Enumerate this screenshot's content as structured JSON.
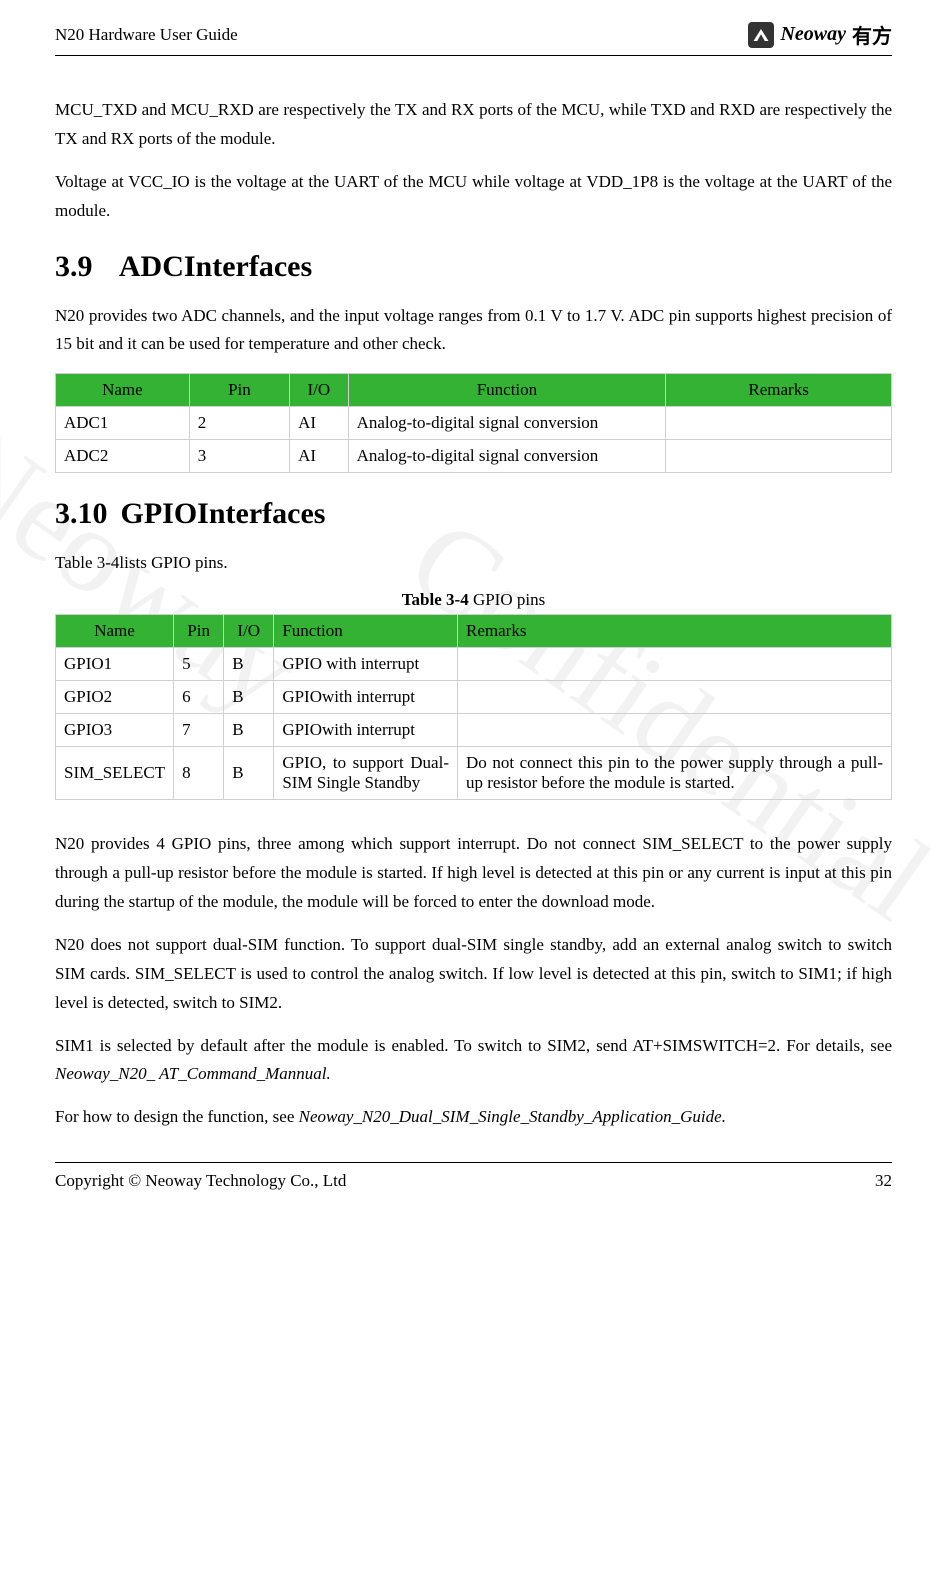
{
  "header": {
    "title": "N20 Hardware User Guide",
    "logo_text": "Neoway",
    "logo_cn": "有方"
  },
  "paras": {
    "p1": "MCU_TXD and MCU_RXD are respectively the TX and RX ports of the MCU, while TXD and RXD are respectively the TX and RX ports of the module.",
    "p2": "Voltage at VCC_IO is the voltage at the UART of the MCU while voltage at VDD_1P8 is the voltage at the UART of the module.",
    "p3": "N20 provides two ADC channels, and the input voltage ranges from 0.1 V to 1.7 V. ADC pin supports highest precision of 15 bit and it can be used for temperature and other check.",
    "p4": "Table 3-4lists GPIO pins.",
    "p5": "N20 provides 4 GPIO pins, three among which support interrupt. Do not connect SIM_SELECT to the power supply through a pull-up resistor before the module is started. If high level is detected at this pin or any current is input at this pin during the startup of the module, the module will be forced to enter the download mode.",
    "p6": "N20 does not support dual-SIM function. To support dual-SIM single standby, add an external analog switch to switch SIM cards. SIM_SELECT is used to control the analog switch. If low level is detected at this pin, switch to SIM1; if high level is detected, switch to SIM2.",
    "p7a": "SIM1 is selected by default after the module is enabled. To switch to SIM2, send AT+SIMSWITCH=2. For details, see ",
    "p7b": "Neoway_N20_ AT_Command_Mannual.",
    "p8a": "For how to design the function, see ",
    "p8b": "Neoway_N20_Dual_SIM_Single_Standby_Application_Guide."
  },
  "sections": {
    "s39_num": "3.9",
    "s39_title": "ADCInterfaces",
    "s310_num": "3.10",
    "s310_title": "GPIOInterfaces"
  },
  "adc_table": {
    "headers": {
      "name": "Name",
      "pin": "Pin",
      "io": "I/O",
      "func": "Function",
      "rem": "Remarks"
    },
    "rows": [
      {
        "name": "ADC1",
        "pin": "2",
        "io": "AI",
        "func": "Analog-to-digital signal conversion",
        "rem": ""
      },
      {
        "name": "ADC2",
        "pin": "3",
        "io": "AI",
        "func": "Analog-to-digital signal conversion",
        "rem": ""
      }
    ]
  },
  "gpio_caption_bold": "Table 3-4",
  "gpio_caption_rest": " GPIO pins",
  "gpio_table": {
    "headers": {
      "name": "Name",
      "pin": "Pin",
      "io": "I/O",
      "func": "Function",
      "rem": "Remarks"
    },
    "rows": [
      {
        "name": "GPIO1",
        "pin": "5",
        "io": "B",
        "func": "GPIO with interrupt",
        "rem": ""
      },
      {
        "name": "GPIO2",
        "pin": "6",
        "io": "B",
        "func": "GPIOwith interrupt",
        "rem": ""
      },
      {
        "name": "GPIO3",
        "pin": "7",
        "io": "B",
        "func": "GPIOwith interrupt",
        "rem": ""
      },
      {
        "name": "SIM_SELECT",
        "pin": "8",
        "io": "B",
        "func": "GPIO, to support Dual-SIM Single Standby",
        "rem": "Do not connect this pin to the power supply through a pull-up resistor before the module is started."
      }
    ]
  },
  "footer": {
    "copyright": "Copyright © Neoway Technology Co., Ltd",
    "page": "32"
  },
  "watermarks": {
    "w1": "Neoway",
    "w2": "Confidential"
  }
}
